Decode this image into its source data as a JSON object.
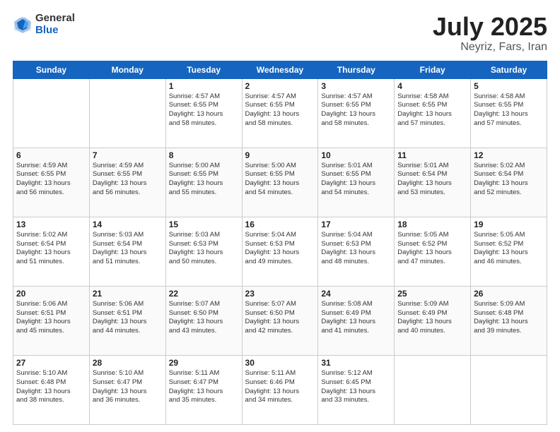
{
  "logo": {
    "general": "General",
    "blue": "Blue"
  },
  "title": {
    "month": "July 2025",
    "location": "Neyriz, Fars, Iran"
  },
  "days_header": [
    "Sunday",
    "Monday",
    "Tuesday",
    "Wednesday",
    "Thursday",
    "Friday",
    "Saturday"
  ],
  "weeks": [
    [
      {
        "day": "",
        "info": ""
      },
      {
        "day": "",
        "info": ""
      },
      {
        "day": "1",
        "info": "Sunrise: 4:57 AM\nSunset: 6:55 PM\nDaylight: 13 hours\nand 58 minutes."
      },
      {
        "day": "2",
        "info": "Sunrise: 4:57 AM\nSunset: 6:55 PM\nDaylight: 13 hours\nand 58 minutes."
      },
      {
        "day": "3",
        "info": "Sunrise: 4:57 AM\nSunset: 6:55 PM\nDaylight: 13 hours\nand 58 minutes."
      },
      {
        "day": "4",
        "info": "Sunrise: 4:58 AM\nSunset: 6:55 PM\nDaylight: 13 hours\nand 57 minutes."
      },
      {
        "day": "5",
        "info": "Sunrise: 4:58 AM\nSunset: 6:55 PM\nDaylight: 13 hours\nand 57 minutes."
      }
    ],
    [
      {
        "day": "6",
        "info": "Sunrise: 4:59 AM\nSunset: 6:55 PM\nDaylight: 13 hours\nand 56 minutes."
      },
      {
        "day": "7",
        "info": "Sunrise: 4:59 AM\nSunset: 6:55 PM\nDaylight: 13 hours\nand 56 minutes."
      },
      {
        "day": "8",
        "info": "Sunrise: 5:00 AM\nSunset: 6:55 PM\nDaylight: 13 hours\nand 55 minutes."
      },
      {
        "day": "9",
        "info": "Sunrise: 5:00 AM\nSunset: 6:55 PM\nDaylight: 13 hours\nand 54 minutes."
      },
      {
        "day": "10",
        "info": "Sunrise: 5:01 AM\nSunset: 6:55 PM\nDaylight: 13 hours\nand 54 minutes."
      },
      {
        "day": "11",
        "info": "Sunrise: 5:01 AM\nSunset: 6:54 PM\nDaylight: 13 hours\nand 53 minutes."
      },
      {
        "day": "12",
        "info": "Sunrise: 5:02 AM\nSunset: 6:54 PM\nDaylight: 13 hours\nand 52 minutes."
      }
    ],
    [
      {
        "day": "13",
        "info": "Sunrise: 5:02 AM\nSunset: 6:54 PM\nDaylight: 13 hours\nand 51 minutes."
      },
      {
        "day": "14",
        "info": "Sunrise: 5:03 AM\nSunset: 6:54 PM\nDaylight: 13 hours\nand 51 minutes."
      },
      {
        "day": "15",
        "info": "Sunrise: 5:03 AM\nSunset: 6:53 PM\nDaylight: 13 hours\nand 50 minutes."
      },
      {
        "day": "16",
        "info": "Sunrise: 5:04 AM\nSunset: 6:53 PM\nDaylight: 13 hours\nand 49 minutes."
      },
      {
        "day": "17",
        "info": "Sunrise: 5:04 AM\nSunset: 6:53 PM\nDaylight: 13 hours\nand 48 minutes."
      },
      {
        "day": "18",
        "info": "Sunrise: 5:05 AM\nSunset: 6:52 PM\nDaylight: 13 hours\nand 47 minutes."
      },
      {
        "day": "19",
        "info": "Sunrise: 5:05 AM\nSunset: 6:52 PM\nDaylight: 13 hours\nand 46 minutes."
      }
    ],
    [
      {
        "day": "20",
        "info": "Sunrise: 5:06 AM\nSunset: 6:51 PM\nDaylight: 13 hours\nand 45 minutes."
      },
      {
        "day": "21",
        "info": "Sunrise: 5:06 AM\nSunset: 6:51 PM\nDaylight: 13 hours\nand 44 minutes."
      },
      {
        "day": "22",
        "info": "Sunrise: 5:07 AM\nSunset: 6:50 PM\nDaylight: 13 hours\nand 43 minutes."
      },
      {
        "day": "23",
        "info": "Sunrise: 5:07 AM\nSunset: 6:50 PM\nDaylight: 13 hours\nand 42 minutes."
      },
      {
        "day": "24",
        "info": "Sunrise: 5:08 AM\nSunset: 6:49 PM\nDaylight: 13 hours\nand 41 minutes."
      },
      {
        "day": "25",
        "info": "Sunrise: 5:09 AM\nSunset: 6:49 PM\nDaylight: 13 hours\nand 40 minutes."
      },
      {
        "day": "26",
        "info": "Sunrise: 5:09 AM\nSunset: 6:48 PM\nDaylight: 13 hours\nand 39 minutes."
      }
    ],
    [
      {
        "day": "27",
        "info": "Sunrise: 5:10 AM\nSunset: 6:48 PM\nDaylight: 13 hours\nand 38 minutes."
      },
      {
        "day": "28",
        "info": "Sunrise: 5:10 AM\nSunset: 6:47 PM\nDaylight: 13 hours\nand 36 minutes."
      },
      {
        "day": "29",
        "info": "Sunrise: 5:11 AM\nSunset: 6:47 PM\nDaylight: 13 hours\nand 35 minutes."
      },
      {
        "day": "30",
        "info": "Sunrise: 5:11 AM\nSunset: 6:46 PM\nDaylight: 13 hours\nand 34 minutes."
      },
      {
        "day": "31",
        "info": "Sunrise: 5:12 AM\nSunset: 6:45 PM\nDaylight: 13 hours\nand 33 minutes."
      },
      {
        "day": "",
        "info": ""
      },
      {
        "day": "",
        "info": ""
      }
    ]
  ]
}
